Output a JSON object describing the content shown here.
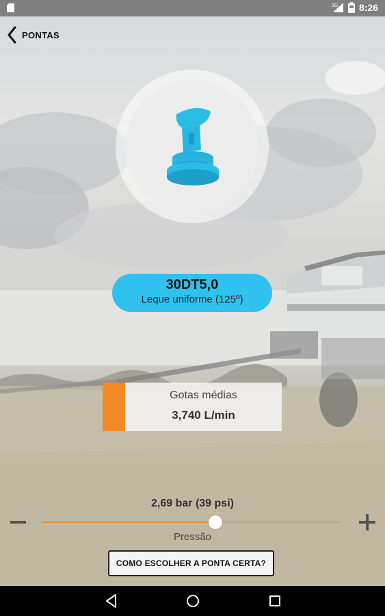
{
  "status_bar": {
    "time": "8:26",
    "network_label": "3G",
    "icons": [
      "sim-card-icon",
      "signal-icon",
      "battery-icon"
    ]
  },
  "header": {
    "back_label": "PONTAS",
    "back_icon": "chevron-left-icon"
  },
  "product": {
    "image_icon": "nozzle-icon",
    "image_color": "#2fc2ef",
    "code": "30DT5,0",
    "description": "Leque uniforme (125º)",
    "pill_color": "#2fc2ef"
  },
  "droplet_info": {
    "title": "Gotas médias",
    "flow": "3,740 L/min",
    "color": "#f28a26"
  },
  "pressure": {
    "value_label": "2,69 bar (39 psi)",
    "label": "Pressão",
    "slider_fraction": 0.58,
    "accent_color": "#f28a26"
  },
  "actions": {
    "help_button": "COMO ESCOLHER A PONTA CERTA?"
  },
  "nav_bar": {
    "buttons": [
      "back-triangle-icon",
      "home-circle-icon",
      "recents-square-icon"
    ]
  }
}
